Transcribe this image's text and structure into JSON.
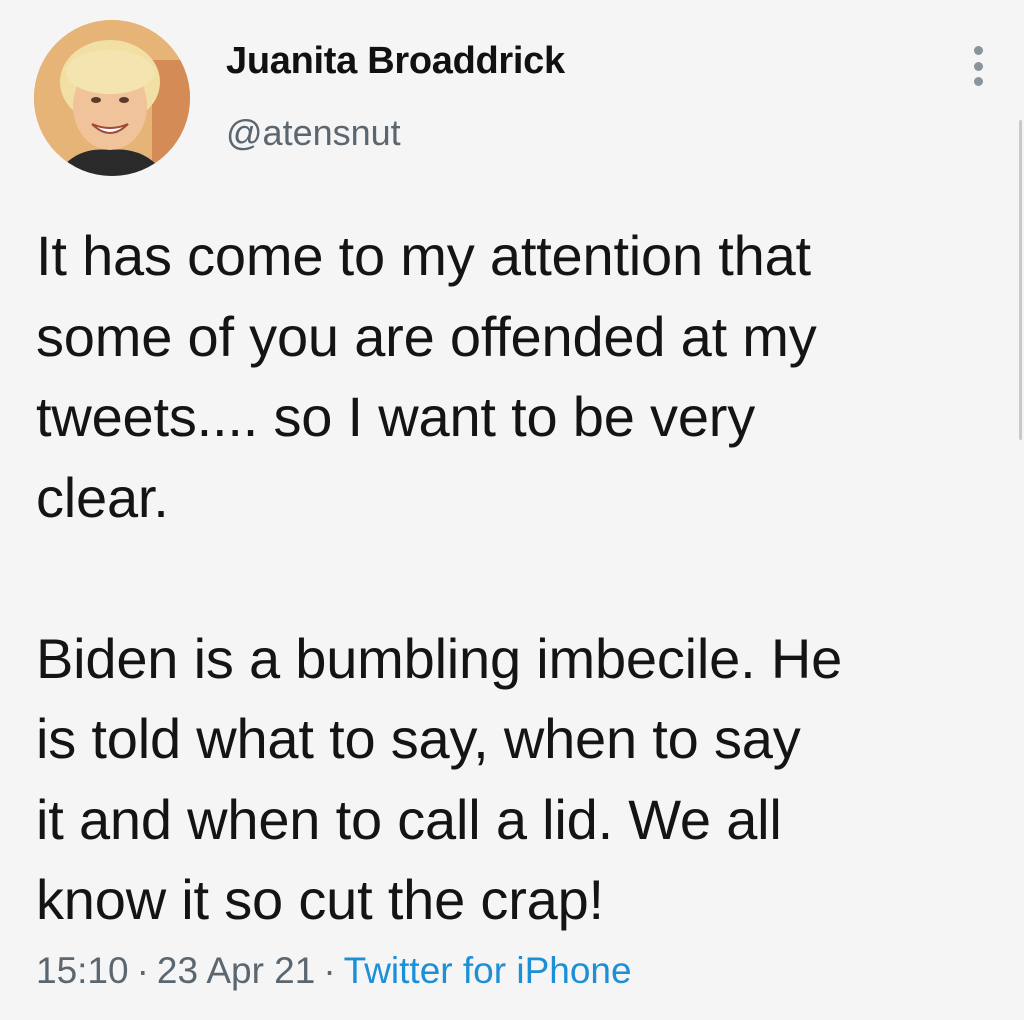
{
  "author": {
    "name": "Juanita Broaddrick",
    "handle": "@atensnut",
    "avatar_icon": "profile-photo"
  },
  "menu": {
    "icon": "more-vertical-icon"
  },
  "tweet": {
    "paragraph_1": "It has come to my attention that\nsome of you are offended at my\ntweets.... so I want to be very\nclear.",
    "paragraph_2": "Biden is a  bumbling imbecile. He\nis told what to say, when to say\nit and when to call a lid.  We all\nknow it so cut the crap!"
  },
  "meta": {
    "time": "15:10",
    "separator": "·",
    "date": "23 Apr 21",
    "source": "Twitter for iPhone"
  },
  "colors": {
    "background": "#f5f5f5",
    "text": "#141414",
    "secondary": "#5b6770",
    "link": "#1d8fd6"
  }
}
